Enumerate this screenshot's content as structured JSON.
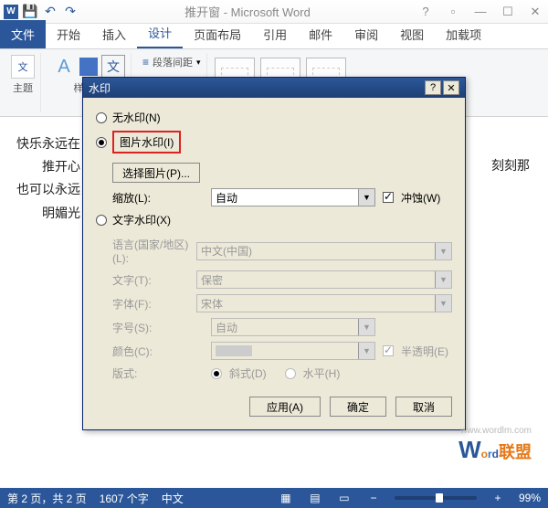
{
  "titlebar": {
    "title": "推开窗 - Microsoft Word"
  },
  "tabs": {
    "file": "文件",
    "home": "开始",
    "insert": "插入",
    "design": "设计",
    "layout": "页面布局",
    "ref": "引用",
    "mail": "邮件",
    "review": "审阅",
    "view": "视图",
    "addin": "加载项"
  },
  "ribbon": {
    "themes": "主题",
    "styles": "样式集",
    "spacing": "段落间距"
  },
  "doc": {
    "l1": "快乐永远在",
    "l2": "推开心",
    "l3": "也可以永远",
    "l4": "明媚光",
    "l5": "刻刻那"
  },
  "dialog": {
    "title": "水印",
    "noWatermark": "无水印(N)",
    "picWatermark": "图片水印(I)",
    "selectPic": "选择图片(P)...",
    "scale": "缩放(L):",
    "scaleVal": "自动",
    "erode": "冲蚀(W)",
    "textWatermark": "文字水印(X)",
    "lang": "语言(国家/地区)(L):",
    "langVal": "中文(中国)",
    "text": "文字(T):",
    "textVal": "保密",
    "font": "字体(F):",
    "fontVal": "宋体",
    "size": "字号(S):",
    "sizeVal": "自动",
    "color": "颜色(C):",
    "semi": "半透明(E)",
    "layout": "版式:",
    "diag": "斜式(D)",
    "horiz": "水平(H)",
    "apply": "应用(A)",
    "ok": "确定",
    "cancel": "取消"
  },
  "status": {
    "page": "第 2 页，共 2 页",
    "words": "1607 个字",
    "lang": "中文",
    "zoom": "99%"
  },
  "logo": {
    "url": "www.wordlm.com",
    "cn": "联盟"
  }
}
